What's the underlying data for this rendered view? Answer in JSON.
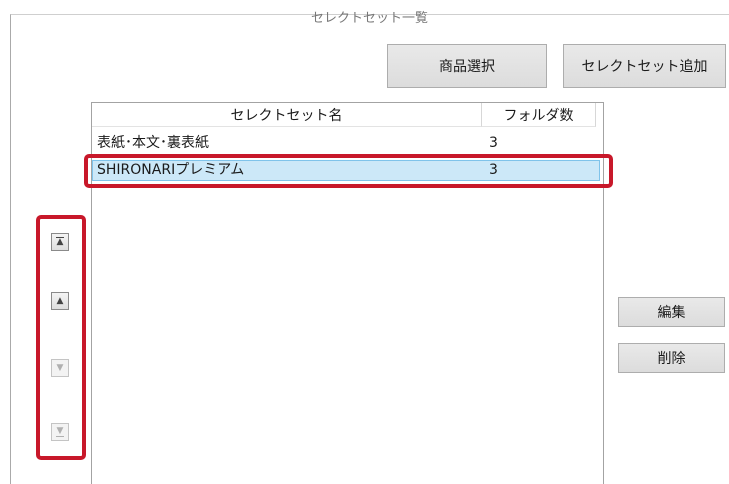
{
  "window": {
    "title": "セレクトセット一覧"
  },
  "toolbar": {
    "select_product_label": "商品選択",
    "add_selectset_label": "セレクトセット追加"
  },
  "list": {
    "headers": {
      "name": "セレクトセット名",
      "folder_count": "フォルダ数"
    },
    "rows": [
      {
        "name": "表紙･本文･裏表紙",
        "folder_count": "3",
        "selected": false
      },
      {
        "name": "SHIRONARIプレミアム",
        "folder_count": "3",
        "selected": true
      }
    ]
  },
  "side_actions": {
    "edit_label": "編集",
    "delete_label": "削除"
  },
  "order_controls": {
    "move_top_icon": "move-to-top-icon",
    "move_up_icon": "move-up-icon",
    "move_down_icon": "move-down-icon",
    "move_bottom_icon": "move-to-bottom-icon",
    "move_down_enabled": false,
    "move_bottom_enabled": false
  },
  "annotations": {
    "highlight_color": "#c8182a",
    "selection_color": "#cce8f8"
  }
}
